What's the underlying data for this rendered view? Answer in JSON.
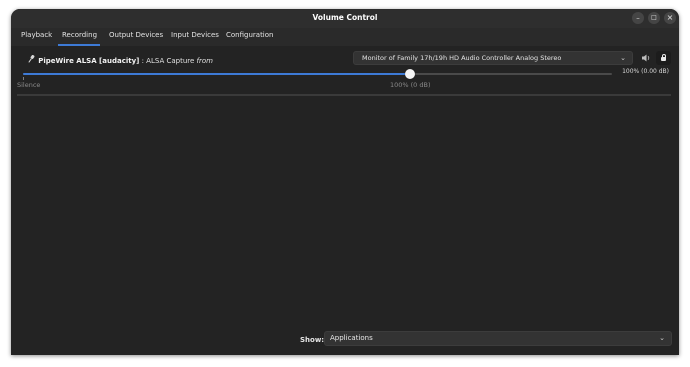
{
  "window": {
    "title": "Volume Control",
    "controls": {
      "minimize": "–",
      "maximize": "□",
      "close": "×"
    }
  },
  "tabs": [
    {
      "label": "Playback"
    },
    {
      "label": "Recording"
    },
    {
      "label": "Output Devices"
    },
    {
      "label": "Input Devices"
    },
    {
      "label": "Configuration"
    }
  ],
  "selected_tab": "Recording",
  "stream": {
    "icon": "microphone-icon",
    "app_name": "PipeWire ALSA [audacity]",
    "separator": ": ALSA Capture",
    "from_label": "from",
    "device": "Monitor of Family 17h/19h HD Audio Controller Analog Stereo",
    "volume_percent": 100,
    "volume_fraction": 0.657,
    "volume_label": "100% (0.00 dB)",
    "scale_min_label": "Silence",
    "scale_mark_label": "100% (0 dB)",
    "mute_icon": "speaker-icon",
    "lock_icon": "lock-icon",
    "locked": true
  },
  "footer": {
    "show_label": "Show:",
    "show_value": "Applications"
  },
  "colors": {
    "accent": "#3d7ad6",
    "window_bg": "#2a2a2a",
    "content_bg": "#232323"
  }
}
